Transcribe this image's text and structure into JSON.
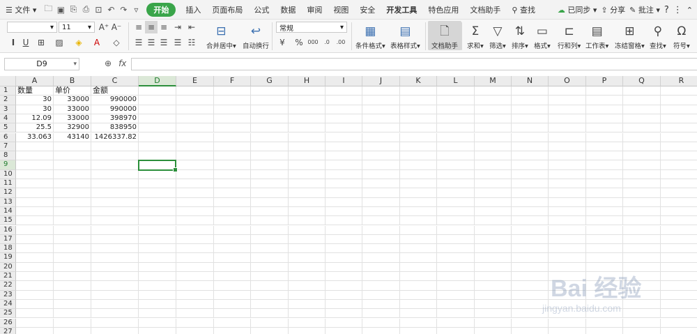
{
  "menubar": {
    "file": "文件",
    "tabs": [
      "开始",
      "插入",
      "页面布局",
      "公式",
      "数据",
      "审阅",
      "视图",
      "安全",
      "开发工具",
      "特色应用",
      "文档助手"
    ],
    "search": "查找",
    "sync": "已同步",
    "share": "分享",
    "comment": "批注"
  },
  "ribbon": {
    "font_name": "",
    "font_size": "11",
    "number_format": "常规",
    "merge_center": "合并居中",
    "wrap_text": "自动换行",
    "cond_format": "条件格式",
    "table_style": "表格样式",
    "doc_helper": "文档助手",
    "sum": "求和",
    "filter": "筛选",
    "sort": "排序",
    "format": "格式",
    "row_col": "行和列",
    "sheet": "工作表",
    "freeze": "冻结窗格",
    "find": "查找",
    "symbol": "符号"
  },
  "formula_bar": {
    "name_box": "D9",
    "fx": "fx",
    "value": ""
  },
  "sheet": {
    "columns": [
      "A",
      "B",
      "C",
      "D",
      "E",
      "F",
      "G",
      "H",
      "I",
      "J",
      "K",
      "L",
      "M",
      "N",
      "O",
      "P",
      "Q",
      "R"
    ],
    "active_cell": "D9",
    "rows": [
      {
        "A": "数量",
        "B": "单价",
        "C": "金额"
      },
      {
        "A": "30",
        "B": "33000",
        "C": "990000"
      },
      {
        "A": "30",
        "B": "33000",
        "C": "990000"
      },
      {
        "A": "12.09",
        "B": "33000",
        "C": "398970"
      },
      {
        "A": "25.5",
        "B": "32900",
        "C": "838950"
      },
      {
        "A": "33.063",
        "B": "43140",
        "C": "1426337.82"
      }
    ],
    "row_count": 27
  },
  "watermark": {
    "line1": "Bai 经验",
    "line2": "jingyan.baidu.com"
  }
}
